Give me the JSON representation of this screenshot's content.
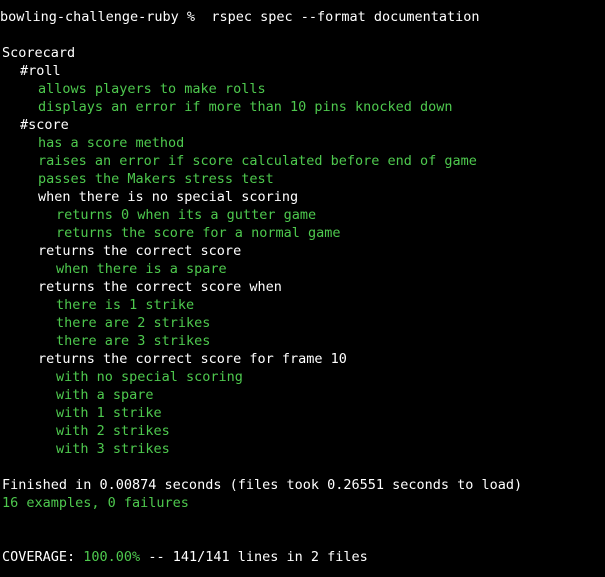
{
  "terminal": {
    "prompt": "bowling-challenge-ruby %  rspec spec --format documentation",
    "colors": {
      "background": "#000000",
      "text": "#ffffff",
      "pass": "#4ec94e"
    }
  },
  "spec": {
    "describe": "Scorecard",
    "roll": {
      "heading": "#roll",
      "examples": [
        "allows players to make rolls",
        "displays an error if more than 10 pins knocked down"
      ]
    },
    "score": {
      "heading": "#score",
      "examples": [
        "has a score method",
        "raises an error if score calculated before end of game",
        "passes the Makers stress test"
      ],
      "contexts": [
        {
          "heading": "when there is no special scoring",
          "examples": [
            "returns 0 when its a gutter game",
            "returns the score for a normal game"
          ]
        },
        {
          "heading": "returns the correct score",
          "examples": [
            "when there is a spare"
          ]
        },
        {
          "heading": "returns the correct score when",
          "examples": [
            "there is 1 strike",
            "there are 2 strikes",
            "there are 3 strikes"
          ]
        },
        {
          "heading": "returns the correct score for frame 10",
          "examples": [
            "with no special scoring",
            "with a spare",
            "with 1 strike",
            "with 2 strikes",
            "with 3 strikes"
          ]
        }
      ]
    }
  },
  "summary": {
    "finished": "Finished in 0.00874 seconds (files took 0.26551 seconds to load)",
    "result": "16 examples, 0 failures"
  },
  "coverage": {
    "label": "COVERAGE: ",
    "percent": "100.00%",
    "detail": " -- 141/141 lines in 2 files"
  }
}
